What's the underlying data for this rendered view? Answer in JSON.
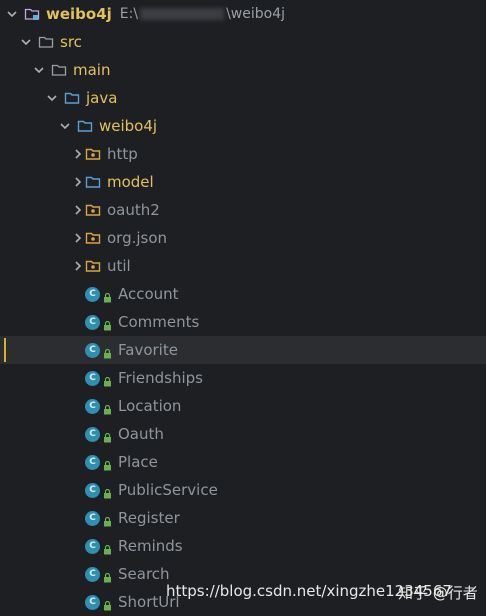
{
  "module": {
    "name": "weibo4j",
    "path_prefix": "E:\\",
    "path_suffix": "\\weibo4j"
  },
  "tree": {
    "src": "src",
    "main": "main",
    "java": "java",
    "package": "weibo4j",
    "subpackages": [
      "http",
      "model",
      "oauth2",
      "org.json",
      "util"
    ],
    "classes": [
      "Account",
      "Comments",
      "Favorite",
      "Friendships",
      "Location",
      "Oauth",
      "Place",
      "PublicService",
      "Register",
      "Reminds",
      "Search",
      "ShortUrl"
    ],
    "selected_class": "Favorite"
  },
  "icons": {
    "chevron_down": "chevron-down-icon",
    "chevron_right": "chevron-right-icon",
    "folder": "folder-icon",
    "package": "package-icon",
    "class": "class-icon",
    "class_letter": "C"
  },
  "watermark": {
    "url": "https://blog.csdn.net/xingzhe1234567",
    "zhihu": "知乎 @行者"
  },
  "colors": {
    "background": "#1e1f22",
    "highlight": "#e3c25b",
    "muted": "#8f969d",
    "class_icon": "#2e8fb0",
    "selection_bar": "#d6b22a"
  }
}
